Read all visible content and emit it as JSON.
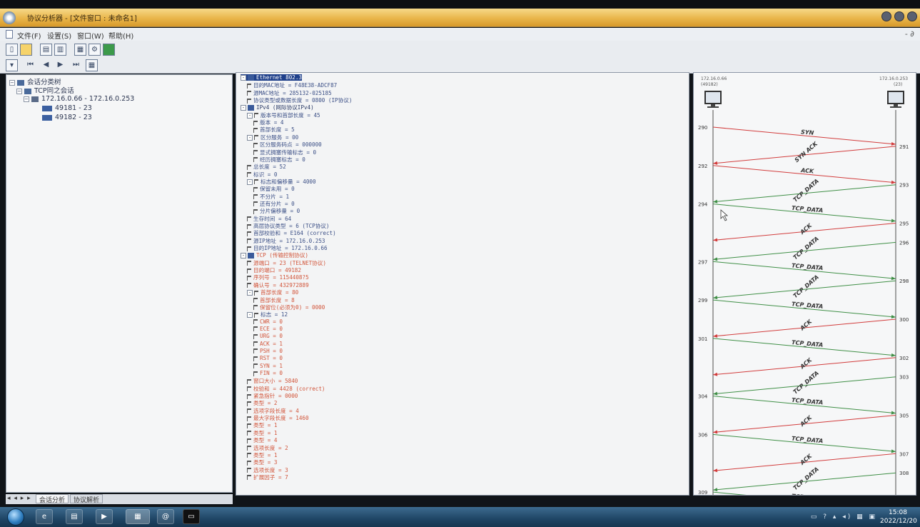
{
  "window": {
    "title": "协议分析器 - [文件窗口 : 未命名1]"
  },
  "menu": [
    "文件(F)",
    "设置(S)",
    "窗口(W)",
    "帮助(H)"
  ],
  "mdi_controls": "- ∂",
  "session_tree": {
    "root": "会话分类树",
    "group": "TCP同之会话",
    "connection": "172.16.0.66 - 172.16.0.253",
    "sessions": [
      "49181 - 23",
      "49182 - 23"
    ]
  },
  "bottom_tabs": {
    "nav": "◂ ◂ ▸ ▸",
    "tabs": [
      "会话分析",
      "协议解析"
    ]
  },
  "packet_detail": [
    {
      "depth": 0,
      "text": "Ethernet 802.3",
      "kind": "sel",
      "node": "-"
    },
    {
      "depth": 1,
      "text": "目的MAC地址 = F48E38-ADCF87",
      "kind": "field"
    },
    {
      "depth": 1,
      "text": "源MAC地址 = 285132-025185",
      "kind": "field"
    },
    {
      "depth": 1,
      "text": "协议类型或数据长度 = 0800 (IP协议)",
      "kind": "field"
    },
    {
      "depth": 0,
      "text": "IPv4 (网际协议IPv4)",
      "kind": "top",
      "node": "-"
    },
    {
      "depth": 1,
      "text": "版本号和首部长度 = 45",
      "kind": "field",
      "node": "-"
    },
    {
      "depth": 2,
      "text": "版本 = 4",
      "kind": "field"
    },
    {
      "depth": 2,
      "text": "首部长度 = 5",
      "kind": "field"
    },
    {
      "depth": 1,
      "text": "区分服务 = 00",
      "kind": "field",
      "node": "-"
    },
    {
      "depth": 2,
      "text": "区分服务码点 = 000000",
      "kind": "field"
    },
    {
      "depth": 2,
      "text": "显式拥塞传输标志 = 0",
      "kind": "field"
    },
    {
      "depth": 2,
      "text": "经历拥塞标志 = 0",
      "kind": "field"
    },
    {
      "depth": 1,
      "text": "总长度 = 52",
      "kind": "field"
    },
    {
      "depth": 1,
      "text": "标识 = 0",
      "kind": "field"
    },
    {
      "depth": 1,
      "text": "标志和偏移量 = 4000",
      "kind": "field",
      "node": "-"
    },
    {
      "depth": 2,
      "text": "保留未用 = 0",
      "kind": "field"
    },
    {
      "depth": 2,
      "text": "不分片 = 1",
      "kind": "field"
    },
    {
      "depth": 2,
      "text": "还有分片 = 0",
      "kind": "field"
    },
    {
      "depth": 2,
      "text": "分片偏移量 = 0",
      "kind": "field"
    },
    {
      "depth": 1,
      "text": "生存时间 = 64",
      "kind": "field"
    },
    {
      "depth": 1,
      "text": "高层协议类型 = 6 (TCP协议)",
      "kind": "field"
    },
    {
      "depth": 1,
      "text": "首部校验和 = E164 (correct)",
      "kind": "field"
    },
    {
      "depth": 1,
      "text": "源IP地址 = 172.16.0.253",
      "kind": "field"
    },
    {
      "depth": 1,
      "text": "目的IP地址 = 172.16.0.66",
      "kind": "field"
    },
    {
      "depth": 0,
      "text": "TCP (传输控制协议)",
      "kind": "topred",
      "node": "-"
    },
    {
      "depth": 1,
      "text": "源端口 = 23 (TELNET协议)",
      "kind": "red"
    },
    {
      "depth": 1,
      "text": "目的端口 = 49182",
      "kind": "red"
    },
    {
      "depth": 1,
      "text": "序列号 = 1154408?5",
      "kind": "red"
    },
    {
      "depth": 1,
      "text": "确认号 = 432972889",
      "kind": "red"
    },
    {
      "depth": 1,
      "text": "首部长度 = 80",
      "kind": "red",
      "node": "-"
    },
    {
      "depth": 2,
      "text": "首部长度 = 8",
      "kind": "red"
    },
    {
      "depth": 2,
      "text": "保留位(必须为0) = 0000",
      "kind": "red"
    },
    {
      "depth": 1,
      "text": "标志 = 12",
      "kind": "field",
      "node": "-"
    },
    {
      "depth": 2,
      "text": "CWR = 0",
      "kind": "red"
    },
    {
      "depth": 2,
      "text": "ECE = 0",
      "kind": "red"
    },
    {
      "depth": 2,
      "text": "URG = 0",
      "kind": "red"
    },
    {
      "depth": 2,
      "text": "ACK = 1",
      "kind": "red"
    },
    {
      "depth": 2,
      "text": "PSH = 0",
      "kind": "red"
    },
    {
      "depth": 2,
      "text": "RST = 0",
      "kind": "red"
    },
    {
      "depth": 2,
      "text": "SYN = 1",
      "kind": "red"
    },
    {
      "depth": 2,
      "text": "FIN = 0",
      "kind": "red"
    },
    {
      "depth": 1,
      "text": "窗口大小 = 5840",
      "kind": "red"
    },
    {
      "depth": 1,
      "text": "校验和 = 4428 (correct)",
      "kind": "red"
    },
    {
      "depth": 1,
      "text": "紧急指针 = 0000",
      "kind": "red"
    },
    {
      "depth": 1,
      "text": "类型 = 2",
      "kind": "red"
    },
    {
      "depth": 1,
      "text": "选项字段长度 = 4",
      "kind": "red"
    },
    {
      "depth": 1,
      "text": "最大字段长度 = 1460",
      "kind": "red"
    },
    {
      "depth": 1,
      "text": "类型 = 1",
      "kind": "red"
    },
    {
      "depth": 1,
      "text": "类型 = 1",
      "kind": "red"
    },
    {
      "depth": 1,
      "text": "类型 = 4",
      "kind": "red"
    },
    {
      "depth": 1,
      "text": "选项长度 = 2",
      "kind": "red"
    },
    {
      "depth": 1,
      "text": "类型 = 1",
      "kind": "red"
    },
    {
      "depth": 1,
      "text": "类型 = 3",
      "kind": "red"
    },
    {
      "depth": 1,
      "text": "选项长度 = 3",
      "kind": "red"
    },
    {
      "depth": 1,
      "text": "扩展因子 = 7",
      "kind": "red"
    }
  ],
  "flow": {
    "left_host": {
      "ip": "172.16.0.66",
      "port": "(49182)"
    },
    "right_host": {
      "ip": "172.16.0.253",
      "port": "(23)"
    },
    "packets": [
      {
        "num": "290",
        "label": "SYN",
        "dir": "right",
        "color": "#d23c3c"
      },
      {
        "num": "291",
        "label": "SYN ACK",
        "dir": "left",
        "color": "#d23c3c"
      },
      {
        "num": "292",
        "label": "ACK",
        "dir": "right",
        "color": "#d23c3c"
      },
      {
        "num": "293",
        "label": "TCP_DATA",
        "dir": "left",
        "color": "#3f8f46"
      },
      {
        "num": "294",
        "label": "TCP_DATA",
        "dir": "right",
        "color": "#3f8f46"
      },
      {
        "num": "295",
        "label": "ACK",
        "dir": "left",
        "color": "#d23c3c"
      },
      {
        "num": "296",
        "label": "TCP_DATA",
        "dir": "left",
        "color": "#3f8f46"
      },
      {
        "num": "297",
        "label": "TCP_DATA",
        "dir": "right",
        "color": "#3f8f46"
      },
      {
        "num": "298",
        "label": "TCP_DATA",
        "dir": "left",
        "color": "#3f8f46"
      },
      {
        "num": "299",
        "label": "TCP_DATA",
        "dir": "right",
        "color": "#3f8f46"
      },
      {
        "num": "300",
        "label": "ACK",
        "dir": "left",
        "color": "#d23c3c"
      },
      {
        "num": "301",
        "label": "TCP_DATA",
        "dir": "right",
        "color": "#3f8f46"
      },
      {
        "num": "302",
        "label": "ACK",
        "dir": "left",
        "color": "#d23c3c"
      },
      {
        "num": "303",
        "label": "TCP_DATA",
        "dir": "left",
        "color": "#3f8f46"
      },
      {
        "num": "304",
        "label": "TCP_DATA",
        "dir": "right",
        "color": "#3f8f46"
      },
      {
        "num": "305",
        "label": "ACK",
        "dir": "left",
        "color": "#d23c3c"
      },
      {
        "num": "306",
        "label": "TCP_DATA",
        "dir": "right",
        "color": "#3f8f46"
      },
      {
        "num": "307",
        "label": "ACK",
        "dir": "left",
        "color": "#d23c3c"
      },
      {
        "num": "308",
        "label": "TCP_DATA",
        "dir": "left",
        "color": "#3f8f46"
      },
      {
        "num": "309",
        "label": "TCP_DATA",
        "dir": "right",
        "color": "#3f8f46"
      }
    ]
  },
  "taskbar": {
    "clock_time": "15:08",
    "clock_date": "2022/12/20"
  }
}
